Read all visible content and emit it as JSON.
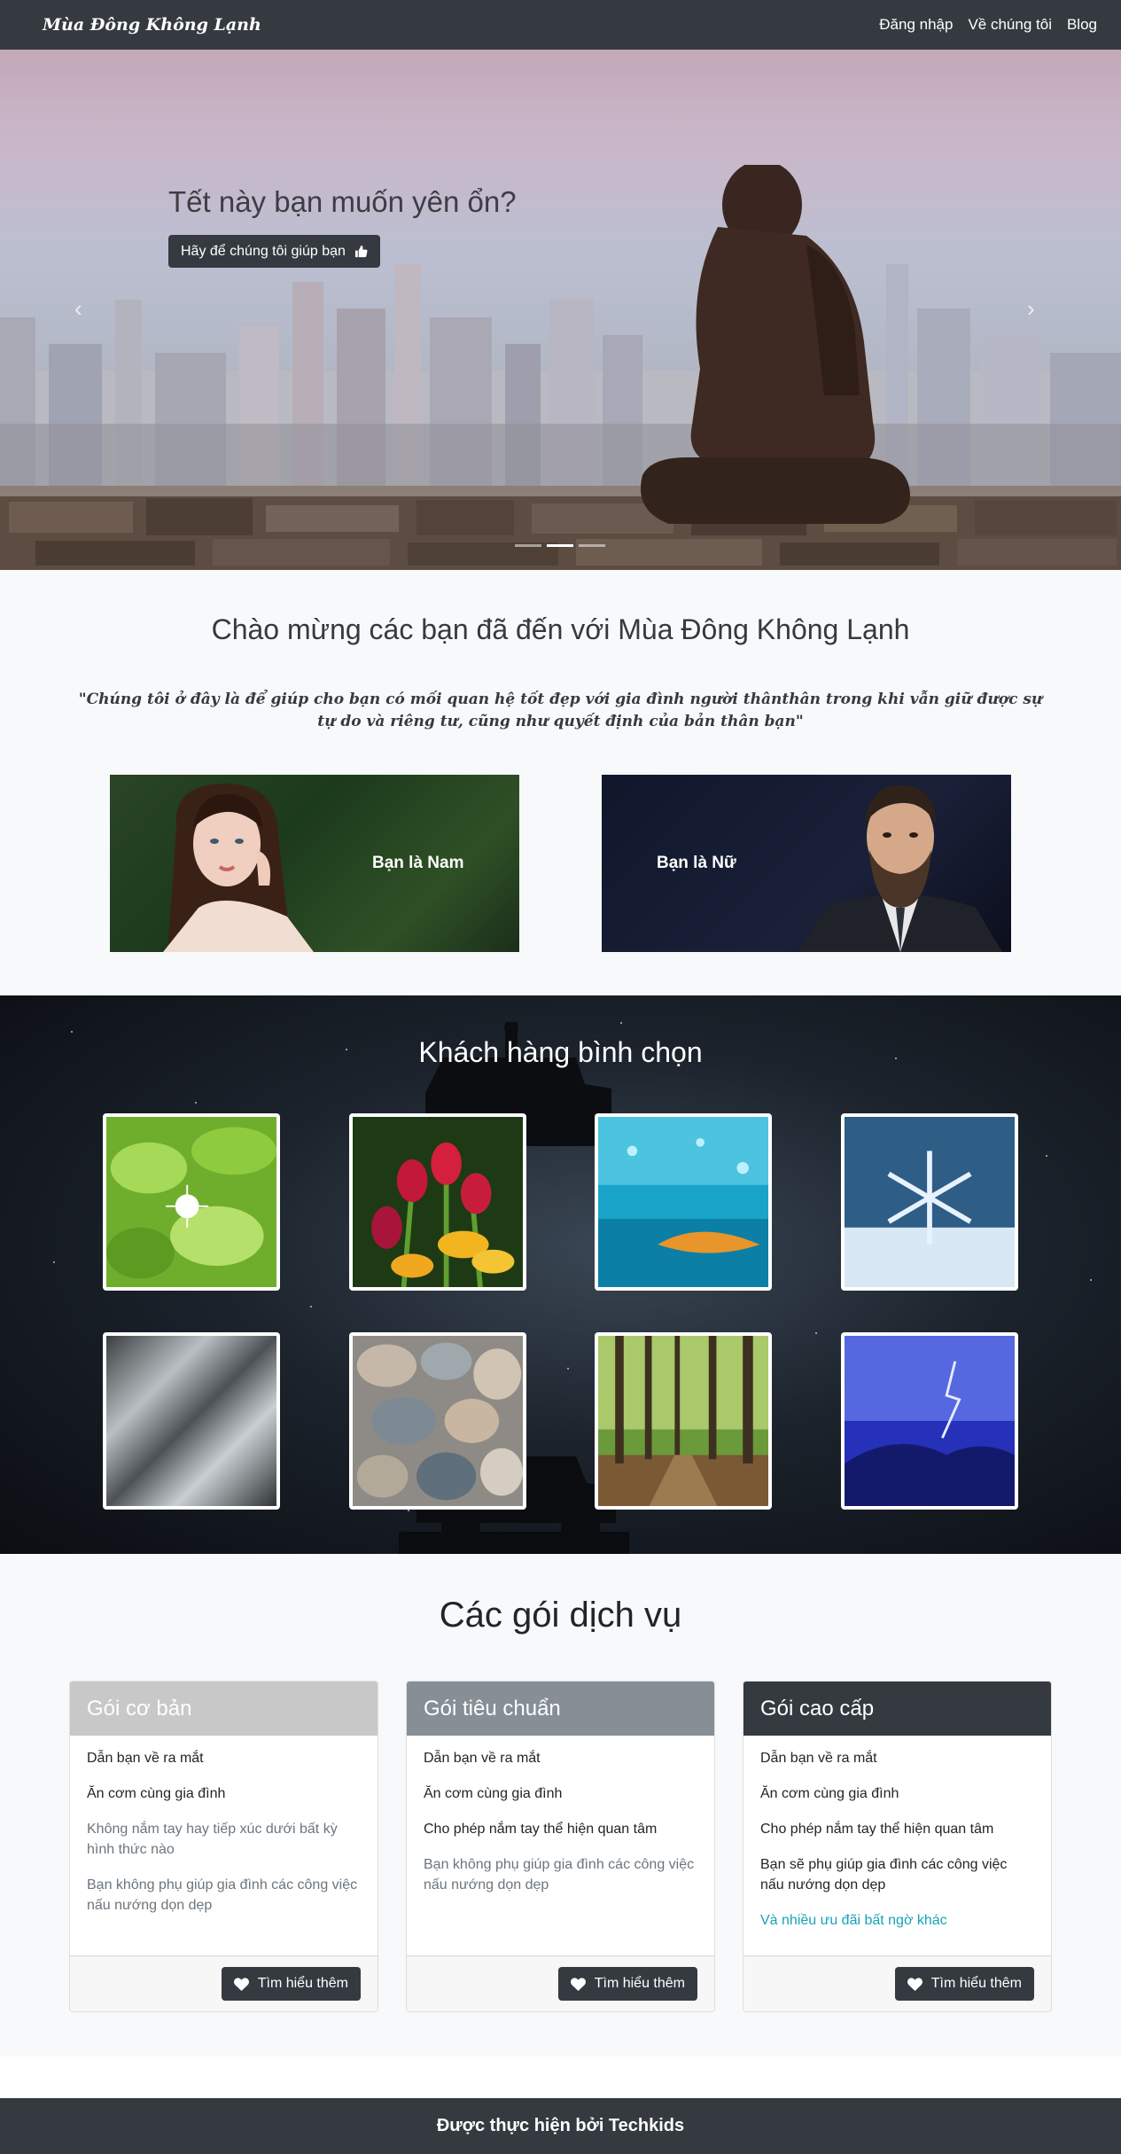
{
  "navbar": {
    "brand": "Mùa Đông Không Lạnh",
    "links": [
      "Đăng nhập",
      "Về chúng tôi",
      "Blog"
    ]
  },
  "hero": {
    "title": "Tết này bạn muốn yên ổn?",
    "button_label": "Hãy để chúng tôi giúp bạn",
    "button_icon": "thumbs-up-icon",
    "slide_count": 3,
    "active_slide": 2
  },
  "welcome": {
    "title": "Chào mừng các bạn đã đến với Mùa Đông Không Lạnh",
    "quote": "\"Chúng tôi ở đây là để giúp cho bạn có mối quan hệ tốt đẹp với gia đình người thânthân trong khi vẫn giữ được sự tự do và riêng tư, cũng như quyết định của bản thân bạn\"",
    "male_label": "Bạn là Nam",
    "female_label": "Bạn là Nữ"
  },
  "votes": {
    "title": "Khách hàng bình chọn",
    "images": [
      "green-leaves",
      "tulips",
      "water-leaf",
      "snowflake",
      "brushed-metal",
      "pebbles",
      "forest-path",
      "lightning"
    ]
  },
  "services": {
    "title": "Các gói dịch vụ",
    "packages": [
      {
        "name": "Gói cơ bản",
        "header_color": "#c8c8c8",
        "items": [
          {
            "text": "Dẫn bạn về ra mắt",
            "style": "normal"
          },
          {
            "text": "Ăn cơm cùng gia đình",
            "style": "normal"
          },
          {
            "text": "Không nắm tay hay tiếp xúc dưới bất kỳ hình thức nào",
            "style": "muted"
          },
          {
            "text": "Bạn không phụ giúp gia đình các công việc nấu nướng dọn dẹp",
            "style": "muted"
          }
        ],
        "button": "Tìm hiểu thêm"
      },
      {
        "name": "Gói tiêu chuẩn",
        "header_color": "#868e96",
        "items": [
          {
            "text": "Dẫn bạn về ra mắt",
            "style": "normal"
          },
          {
            "text": "Ăn cơm cùng gia đình",
            "style": "normal"
          },
          {
            "text": "Cho phép nắm tay thể hiện quan tâm",
            "style": "normal"
          },
          {
            "text": "Bạn không phụ giúp gia đình các công việc nấu nướng dọn dẹp",
            "style": "muted"
          }
        ],
        "button": "Tìm hiểu thêm"
      },
      {
        "name": "Gói cao cấp",
        "header_color": "#343a40",
        "items": [
          {
            "text": "Dẫn bạn về ra mắt",
            "style": "normal"
          },
          {
            "text": "Ăn cơm cùng gia đình",
            "style": "normal"
          },
          {
            "text": "Cho phép nắm tay thể hiện quan tâm",
            "style": "normal"
          },
          {
            "text": "Bạn sẽ phụ giúp gia đình các công việc nấu nướng dọn dẹp",
            "style": "normal"
          },
          {
            "text": "Và nhiều ưu đãi bất ngờ khác",
            "style": "info"
          }
        ],
        "button": "Tìm hiểu thêm"
      }
    ]
  },
  "footer": {
    "text": "Được thực hiện bởi Techkids"
  },
  "colors": {
    "dark": "#343a40",
    "light": "#f8f9fa",
    "info": "#17a2b8",
    "muted": "#6c757d"
  }
}
